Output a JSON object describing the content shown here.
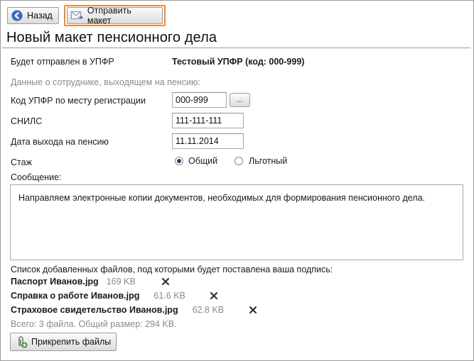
{
  "toolbar": {
    "back_label": "Назад",
    "send_label": "Отправить макет"
  },
  "page_title": "Новый макет пенсионного дела",
  "recipient": {
    "label": "Будет отправлен в УПФР",
    "value": "Тестовый УПФР (код: 000-999)"
  },
  "employee_section": "Данные о сотруднике, выходящем на пенсию:",
  "fields": {
    "upfr_code_label": "Код УПФР по месту регистрации",
    "upfr_code_value": "000-999",
    "browse_label": "...",
    "snils_label": "СНИЛС",
    "snils_value": "111-111-111",
    "retire_date_label": "Дата выхода на пенсию",
    "retire_date_value": "11.11.2014",
    "stazh_label": "Стаж",
    "stazh_options": [
      "Общий",
      "Льготный"
    ],
    "stazh_selected": "Общий"
  },
  "message": {
    "label": "Сообщение:",
    "text": "Направляем электронные копии документов, необходимых для формирования пенсионного дела."
  },
  "files": {
    "header": "Список добавленных файлов, под которыми будет поставлена ваша подпись:",
    "items": [
      {
        "name": "Паспорт Иванов.jpg",
        "size": "169 KB",
        "removable": false
      },
      {
        "name": "Справка о работе Иванов.jpg",
        "size": "61.6 KB",
        "removable": true
      },
      {
        "name": "Страховое свидетельство Иванов.jpg",
        "size": "62.8 KB",
        "removable": true
      }
    ],
    "summary": "Всего: 3 файла. Общий размер: 294 KB.",
    "attach_label": "Прикрепить файлы"
  },
  "colors": {
    "highlight": "#ef8a2c",
    "back_icon": "#2e5aa7",
    "muted_text": "#8a8a8a"
  }
}
